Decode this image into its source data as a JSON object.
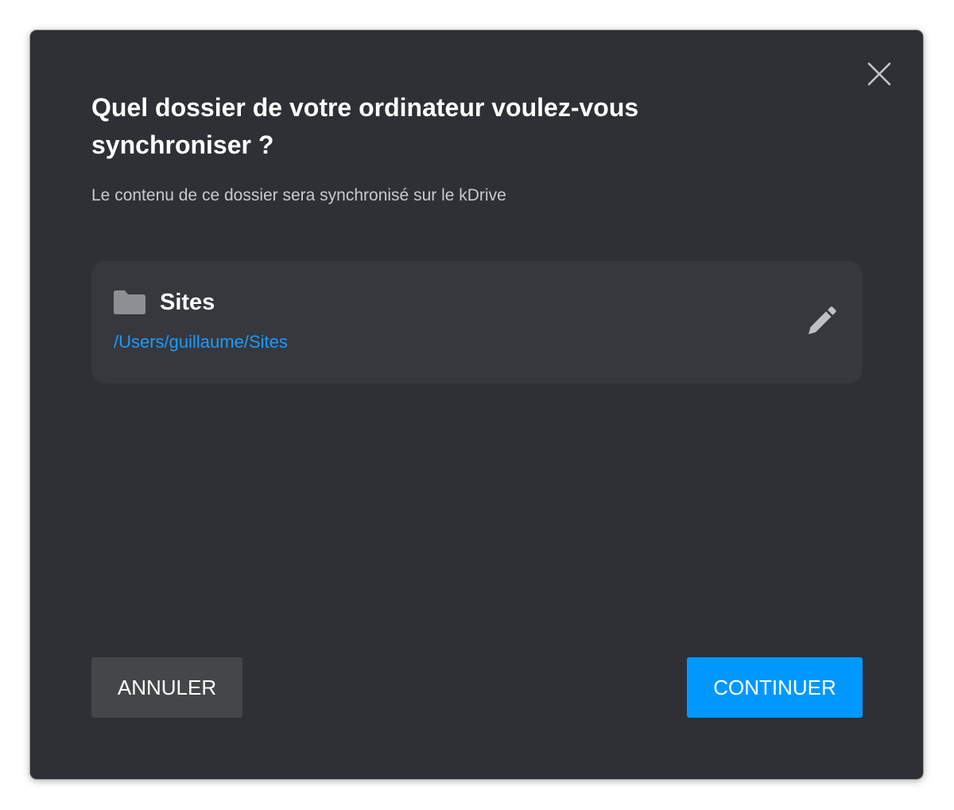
{
  "dialog": {
    "title": "Quel dossier de votre ordinateur voulez-vous synchroniser ?",
    "subtitle": "Le contenu de ce dossier sera synchronisé sur le kDrive",
    "close_icon": "close-icon"
  },
  "folder": {
    "name": "Sites",
    "path": "/Users/guillaume/Sites",
    "icon": "folder-icon",
    "edit_icon": "pencil-icon"
  },
  "buttons": {
    "cancel_label": "ANNULER",
    "continue_label": "CONTINUER"
  },
  "colors": {
    "dialog_background": "#2e3035",
    "card_background": "#36383d",
    "accent": "#0098ff",
    "path_link": "#1a9bff",
    "cancel_button": "#454648"
  }
}
